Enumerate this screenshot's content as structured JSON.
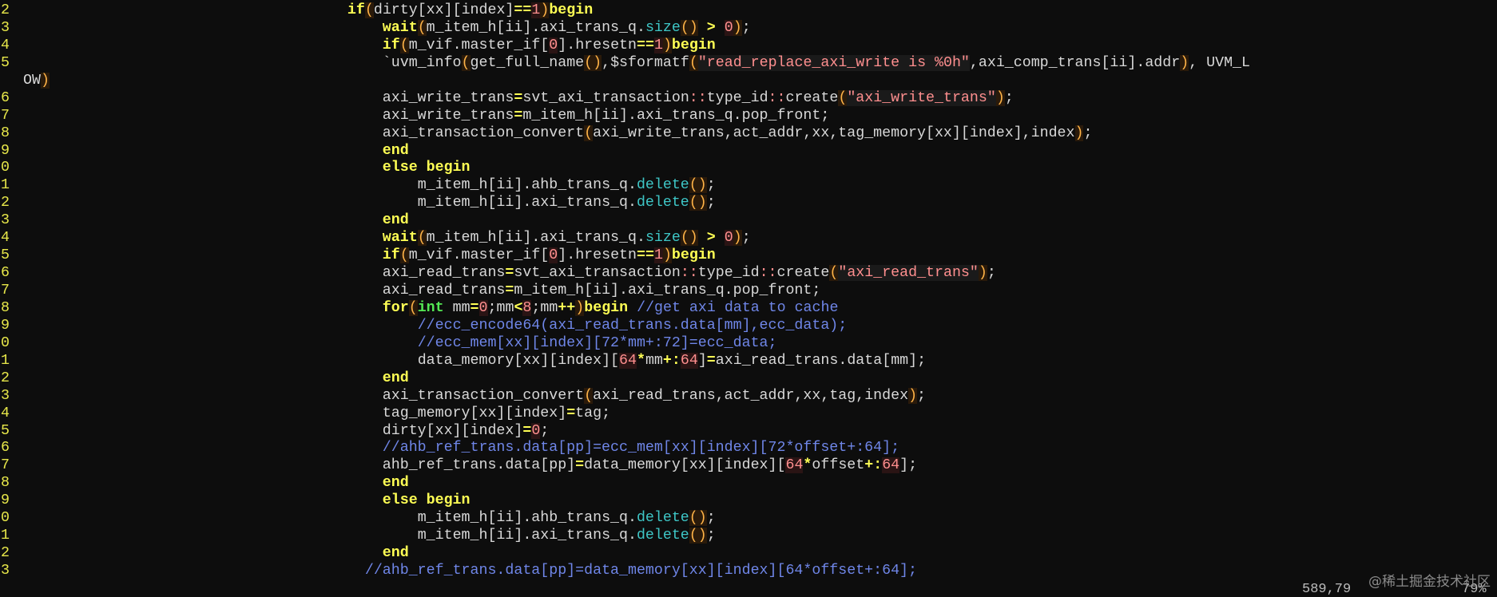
{
  "editor": {
    "lines": [
      {
        "n": "2",
        "indent": 37,
        "segs": [
          [
            "kw",
            "if"
          ],
          [
            "par",
            "("
          ],
          [
            "t",
            "dirty[xx][index]"
          ],
          [
            "op",
            "=="
          ],
          [
            "num2",
            "1"
          ],
          [
            "par",
            ")"
          ],
          [
            "kw",
            "begin"
          ]
        ]
      },
      {
        "n": "3",
        "indent": 41,
        "segs": [
          [
            "kw",
            "wait"
          ],
          [
            "par",
            "("
          ],
          [
            "t",
            "m_item_h[ii].axi_trans_q."
          ],
          [
            "fn",
            "size"
          ],
          [
            "par",
            "()"
          ],
          [
            "t",
            " "
          ],
          [
            "op",
            ">"
          ],
          [
            "t",
            " "
          ],
          [
            "num2",
            "0"
          ],
          [
            "par",
            ")"
          ],
          [
            "t",
            ";"
          ]
        ]
      },
      {
        "n": "4",
        "indent": 41,
        "segs": [
          [
            "kw",
            "if"
          ],
          [
            "par",
            "("
          ],
          [
            "t",
            "m_vif.master_if["
          ],
          [
            "num2",
            "0"
          ],
          [
            "t",
            "].hresetn"
          ],
          [
            "op",
            "=="
          ],
          [
            "num2",
            "1"
          ],
          [
            "par",
            ")"
          ],
          [
            "kw",
            "begin"
          ]
        ]
      },
      {
        "n": "5",
        "indent": 41,
        "segs": [
          [
            "t",
            "`uvm_info"
          ],
          [
            "par",
            "("
          ],
          [
            "t",
            "get_full_name"
          ],
          [
            "par",
            "()"
          ],
          [
            "t",
            ",$sformatf"
          ],
          [
            "par",
            "("
          ],
          [
            "str",
            "\"read_replace_axi_write is %0h\""
          ],
          [
            "t",
            ",axi_comp_trans[ii].addr"
          ],
          [
            "par",
            ")"
          ],
          [
            "t",
            ", UVM_L"
          ]
        ]
      },
      {
        "n": "",
        "indent": 0,
        "segs": [
          [
            "t",
            "OW"
          ],
          [
            "par",
            ")"
          ]
        ]
      },
      {
        "n": "6",
        "indent": 41,
        "segs": [
          [
            "t",
            "axi_write_trans"
          ],
          [
            "op",
            "="
          ],
          [
            "t",
            "svt_axi_transaction"
          ],
          [
            "scope",
            "::"
          ],
          [
            "t",
            "type_id"
          ],
          [
            "scope",
            "::"
          ],
          [
            "t",
            "create"
          ],
          [
            "par",
            "("
          ],
          [
            "str",
            "\"axi_write_trans\""
          ],
          [
            "par",
            ")"
          ],
          [
            "t",
            ";"
          ]
        ]
      },
      {
        "n": "7",
        "indent": 41,
        "segs": [
          [
            "t",
            "axi_write_trans"
          ],
          [
            "op",
            "="
          ],
          [
            "t",
            "m_item_h[ii].axi_trans_q.pop_front;"
          ]
        ]
      },
      {
        "n": "8",
        "indent": 41,
        "segs": [
          [
            "t",
            "axi_transaction_convert"
          ],
          [
            "par",
            "("
          ],
          [
            "t",
            "axi_write_trans,act_addr,xx,tag_memory[xx][index],index"
          ],
          [
            "par",
            ")"
          ],
          [
            "t",
            ";"
          ]
        ]
      },
      {
        "n": "9",
        "indent": 41,
        "segs": [
          [
            "kw",
            "end"
          ]
        ]
      },
      {
        "n": "0",
        "indent": 41,
        "segs": [
          [
            "kw",
            "else begin"
          ]
        ]
      },
      {
        "n": "1",
        "indent": 45,
        "segs": [
          [
            "t",
            "m_item_h[ii].ahb_trans_q."
          ],
          [
            "fn",
            "delete"
          ],
          [
            "par",
            "()"
          ],
          [
            "t",
            ";"
          ]
        ]
      },
      {
        "n": "2",
        "indent": 45,
        "segs": [
          [
            "t",
            "m_item_h[ii].axi_trans_q."
          ],
          [
            "fn",
            "delete"
          ],
          [
            "par",
            "()"
          ],
          [
            "t",
            ";"
          ]
        ]
      },
      {
        "n": "3",
        "indent": 41,
        "segs": [
          [
            "kw",
            "end"
          ]
        ]
      },
      {
        "n": "4",
        "indent": 41,
        "segs": [
          [
            "kw",
            "wait"
          ],
          [
            "par",
            "("
          ],
          [
            "t",
            "m_item_h[ii].axi_trans_q."
          ],
          [
            "fn",
            "size"
          ],
          [
            "par",
            "()"
          ],
          [
            "t",
            " "
          ],
          [
            "op",
            ">"
          ],
          [
            "t",
            " "
          ],
          [
            "num2",
            "0"
          ],
          [
            "par",
            ")"
          ],
          [
            "t",
            ";"
          ]
        ]
      },
      {
        "n": "5",
        "indent": 41,
        "segs": [
          [
            "kw",
            "if"
          ],
          [
            "par",
            "("
          ],
          [
            "t",
            "m_vif.master_if["
          ],
          [
            "num2",
            "0"
          ],
          [
            "t",
            "].hresetn"
          ],
          [
            "op",
            "=="
          ],
          [
            "num2",
            "1"
          ],
          [
            "par",
            ")"
          ],
          [
            "kw",
            "begin"
          ]
        ]
      },
      {
        "n": "6",
        "indent": 41,
        "segs": [
          [
            "t",
            "axi_read_trans"
          ],
          [
            "op",
            "="
          ],
          [
            "t",
            "svt_axi_transaction"
          ],
          [
            "scope",
            "::"
          ],
          [
            "t",
            "type_id"
          ],
          [
            "scope",
            "::"
          ],
          [
            "t",
            "create"
          ],
          [
            "par",
            "("
          ],
          [
            "str",
            "\"axi_read_trans\""
          ],
          [
            "par",
            ")"
          ],
          [
            "t",
            ";"
          ]
        ]
      },
      {
        "n": "7",
        "indent": 41,
        "segs": [
          [
            "t",
            "axi_read_trans"
          ],
          [
            "op",
            "="
          ],
          [
            "t",
            "m_item_h[ii].axi_trans_q.pop_front;"
          ]
        ]
      },
      {
        "n": "8",
        "indent": 41,
        "segs": [
          [
            "kw",
            "for"
          ],
          [
            "par",
            "("
          ],
          [
            "ty",
            "int"
          ],
          [
            "t",
            " mm"
          ],
          [
            "op",
            "="
          ],
          [
            "num2",
            "0"
          ],
          [
            "t",
            ";mm"
          ],
          [
            "op",
            "<"
          ],
          [
            "num2",
            "8"
          ],
          [
            "t",
            ";mm"
          ],
          [
            "op",
            "++"
          ],
          [
            "par",
            ")"
          ],
          [
            "kw",
            "begin"
          ],
          [
            "t",
            " "
          ],
          [
            "cm",
            "//get axi data to cache"
          ]
        ]
      },
      {
        "n": "9",
        "indent": 45,
        "segs": [
          [
            "cm",
            "//ecc_encode64(axi_read_trans.data[mm],ecc_data);"
          ]
        ]
      },
      {
        "n": "0",
        "indent": 45,
        "segs": [
          [
            "cm",
            "//ecc_mem[xx][index][72*mm+:72]=ecc_data;"
          ]
        ]
      },
      {
        "n": "1",
        "indent": 45,
        "segs": [
          [
            "t",
            "data_memory[xx][index]["
          ],
          [
            "num2",
            "64"
          ],
          [
            "op",
            "*"
          ],
          [
            "t",
            "mm"
          ],
          [
            "op",
            "+:"
          ],
          [
            "num2",
            "64"
          ],
          [
            "t",
            "]"
          ],
          [
            "op",
            "="
          ],
          [
            "t",
            "axi_read_trans.data[mm];"
          ]
        ]
      },
      {
        "n": "2",
        "indent": 41,
        "segs": [
          [
            "kw",
            "end"
          ]
        ]
      },
      {
        "n": "3",
        "indent": 41,
        "segs": [
          [
            "t",
            "axi_transaction_convert"
          ],
          [
            "par",
            "("
          ],
          [
            "t",
            "axi_read_trans,act_addr,xx,tag,index"
          ],
          [
            "par",
            ")"
          ],
          [
            "t",
            ";"
          ]
        ]
      },
      {
        "n": "4",
        "indent": 41,
        "segs": [
          [
            "t",
            "tag_memory[xx][index]"
          ],
          [
            "op",
            "="
          ],
          [
            "t",
            "tag;"
          ]
        ]
      },
      {
        "n": "5",
        "indent": 41,
        "segs": [
          [
            "t",
            "dirty[xx][index]"
          ],
          [
            "op",
            "="
          ],
          [
            "num2",
            "0"
          ],
          [
            "t",
            ";"
          ]
        ]
      },
      {
        "n": "6",
        "indent": 41,
        "segs": [
          [
            "cm",
            "//ahb_ref_trans.data[pp]=ecc_mem[xx][index][72*offset+:64];"
          ]
        ]
      },
      {
        "n": "7",
        "indent": 41,
        "segs": [
          [
            "t",
            "ahb_ref_trans.data[pp]"
          ],
          [
            "op",
            "="
          ],
          [
            "t",
            "data_memory[xx][index]["
          ],
          [
            "num2",
            "64"
          ],
          [
            "op",
            "*"
          ],
          [
            "t",
            "offset"
          ],
          [
            "op",
            "+:"
          ],
          [
            "num2",
            "64"
          ],
          [
            "t",
            "];"
          ]
        ]
      },
      {
        "n": "8",
        "indent": 41,
        "segs": [
          [
            "kw",
            "end"
          ]
        ]
      },
      {
        "n": "9",
        "indent": 41,
        "segs": [
          [
            "kw",
            "else begin"
          ]
        ]
      },
      {
        "n": "0",
        "indent": 45,
        "segs": [
          [
            "t",
            "m_item_h[ii].ahb_trans_q."
          ],
          [
            "fn",
            "delete"
          ],
          [
            "par",
            "()"
          ],
          [
            "t",
            ";"
          ]
        ]
      },
      {
        "n": "1",
        "indent": 45,
        "segs": [
          [
            "t",
            "m_item_h[ii].axi_trans_q."
          ],
          [
            "fn",
            "delete"
          ],
          [
            "par",
            "()"
          ],
          [
            "t",
            ";"
          ]
        ]
      },
      {
        "n": "2",
        "indent": 41,
        "segs": [
          [
            "kw",
            "end"
          ]
        ]
      },
      {
        "n": "3",
        "indent": 39,
        "segs": [
          [
            "cm",
            "//ahb_ref_trans.data[pp]=data_memory[xx][index][64*offset+:64];"
          ]
        ]
      }
    ]
  },
  "status": {
    "position": "589,79",
    "percent": "79%"
  },
  "watermark": "@稀土掘金技术社区"
}
